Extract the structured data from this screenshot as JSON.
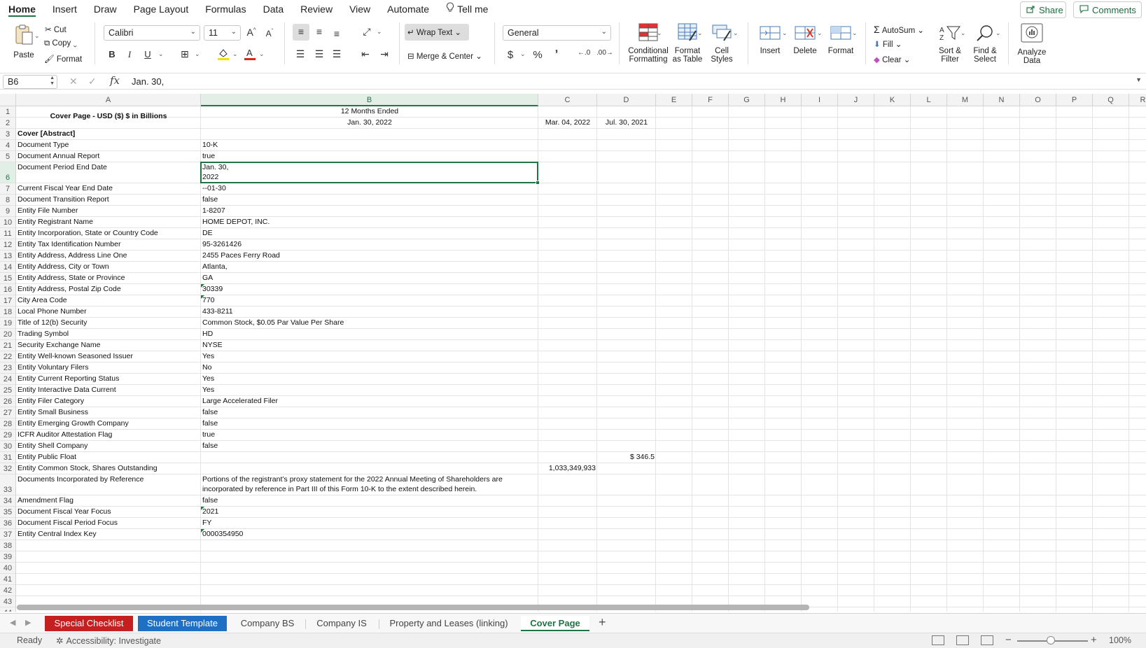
{
  "menu": {
    "tabs": [
      "Home",
      "Insert",
      "Draw",
      "Page Layout",
      "Formulas",
      "Data",
      "Review",
      "View",
      "Automate"
    ],
    "tell_me": "Tell me",
    "share": "Share",
    "comments": "Comments"
  },
  "ribbon": {
    "paste": "Paste",
    "cut": "Cut",
    "copy": "Copy",
    "format_painter": "Format",
    "font_name": "Calibri",
    "font_size": "11",
    "bold": "B",
    "italic": "I",
    "underline": "U",
    "wrap_text": "Wrap Text",
    "merge_center": "Merge & Center",
    "number_format": "General",
    "currency": "$",
    "percent": "%",
    "comma": "ʼ",
    "conditional_formatting": [
      "Conditional",
      "Formatting"
    ],
    "format_as_table": [
      "Format",
      "as Table"
    ],
    "cell_styles": [
      "Cell",
      "Styles"
    ],
    "insert": "Insert",
    "delete": "Delete",
    "format": "Format",
    "autosum": "AutoSum",
    "fill": "Fill",
    "clear": "Clear",
    "sort_filter": [
      "Sort &",
      "Filter"
    ],
    "find_select": [
      "Find &",
      "Select"
    ],
    "analyze_data": [
      "Analyze",
      "Data"
    ]
  },
  "formula_bar": {
    "name_box": "B6",
    "fx": "fx",
    "content": "Jan. 30,"
  },
  "grid": {
    "columns": [
      "A",
      "B",
      "C",
      "D",
      "E",
      "F",
      "G",
      "H",
      "I",
      "J",
      "K",
      "L",
      "M",
      "N",
      "O",
      "P",
      "Q",
      "R"
    ],
    "selected_column": "B",
    "selected_row": "6",
    "row_numbers": [
      "1",
      "2",
      "3",
      "4",
      "5",
      "6",
      "7",
      "8",
      "9",
      "10",
      "11",
      "12",
      "13",
      "14",
      "15",
      "16",
      "17",
      "18",
      "19",
      "20",
      "21",
      "22",
      "23",
      "24",
      "25",
      "26",
      "27",
      "28",
      "29",
      "30",
      "31",
      "32",
      "33",
      "34",
      "35",
      "36",
      "37",
      "38",
      "39",
      "40",
      "41",
      "42",
      "43",
      "44"
    ],
    "header_a": "Cover Page - USD ($) $ in Billions",
    "header_b1": "12 Months Ended",
    "header_b2": "Jan. 30, 2022",
    "header_c2": "Mar. 04, 2022",
    "header_d2": "Jul. 30, 2021",
    "rows": [
      {
        "r": "3",
        "a": "Cover [Abstract]",
        "b": "",
        "c": "",
        "d": ""
      },
      {
        "r": "4",
        "a": "Document Type",
        "b": "10-K",
        "c": "",
        "d": ""
      },
      {
        "r": "5",
        "a": "Document Annual Report",
        "b": "true",
        "c": "",
        "d": ""
      },
      {
        "r": "6",
        "a": "Document Period End Date",
        "b": "Jan. 30,",
        "b2": "2022",
        "c": "",
        "d": ""
      },
      {
        "r": "7",
        "a": "Current Fiscal Year End Date",
        "b": "--01-30",
        "c": "",
        "d": ""
      },
      {
        "r": "8",
        "a": "Document Transition Report",
        "b": "false",
        "c": "",
        "d": ""
      },
      {
        "r": "9",
        "a": "Entity File Number",
        "b": "1-8207",
        "c": "",
        "d": ""
      },
      {
        "r": "10",
        "a": "Entity Registrant Name",
        "b": "HOME DEPOT, INC.",
        "c": "",
        "d": ""
      },
      {
        "r": "11",
        "a": "Entity Incorporation, State or Country Code",
        "b": "DE",
        "c": "",
        "d": ""
      },
      {
        "r": "12",
        "a": "Entity Tax Identification Number",
        "b": "95-3261426",
        "c": "",
        "d": ""
      },
      {
        "r": "13",
        "a": "Entity Address, Address Line One",
        "b": "2455 Paces Ferry Road",
        "c": "",
        "d": ""
      },
      {
        "r": "14",
        "a": "Entity Address, City or Town",
        "b": "Atlanta,",
        "c": "",
        "d": ""
      },
      {
        "r": "15",
        "a": "Entity Address, State or Province",
        "b": "GA",
        "c": "",
        "d": ""
      },
      {
        "r": "16",
        "a": "Entity Address, Postal Zip Code",
        "b": "30339",
        "c": "",
        "d": ""
      },
      {
        "r": "17",
        "a": "City Area Code",
        "b": "770",
        "c": "",
        "d": ""
      },
      {
        "r": "18",
        "a": "Local Phone Number",
        "b": "433-8211",
        "c": "",
        "d": ""
      },
      {
        "r": "19",
        "a": "Title of 12(b) Security",
        "b": "Common Stock, $0.05 Par Value Per Share",
        "c": "",
        "d": ""
      },
      {
        "r": "20",
        "a": "Trading Symbol",
        "b": "HD",
        "c": "",
        "d": ""
      },
      {
        "r": "21",
        "a": "Security Exchange Name",
        "b": "NYSE",
        "c": "",
        "d": ""
      },
      {
        "r": "22",
        "a": "Entity Well-known Seasoned Issuer",
        "b": "Yes",
        "c": "",
        "d": ""
      },
      {
        "r": "23",
        "a": "Entity Voluntary Filers",
        "b": "No",
        "c": "",
        "d": ""
      },
      {
        "r": "24",
        "a": "Entity Current Reporting Status",
        "b": "Yes",
        "c": "",
        "d": ""
      },
      {
        "r": "25",
        "a": "Entity Interactive Data Current",
        "b": "Yes",
        "c": "",
        "d": ""
      },
      {
        "r": "26",
        "a": "Entity Filer Category",
        "b": "Large Accelerated Filer",
        "c": "",
        "d": ""
      },
      {
        "r": "27",
        "a": "Entity Small Business",
        "b": "false",
        "c": "",
        "d": ""
      },
      {
        "r": "28",
        "a": "Entity Emerging Growth Company",
        "b": "false",
        "c": "",
        "d": ""
      },
      {
        "r": "29",
        "a": "ICFR Auditor Attestation Flag",
        "b": "true",
        "c": "",
        "d": ""
      },
      {
        "r": "30",
        "a": "Entity Shell Company",
        "b": "false",
        "c": "",
        "d": ""
      },
      {
        "r": "31",
        "a": "Entity Public Float",
        "b": "",
        "c": "",
        "d": "$ 346.5"
      },
      {
        "r": "32",
        "a": "Entity Common Stock, Shares Outstanding",
        "b": "",
        "c": "1,033,349,933",
        "d": ""
      },
      {
        "r": "33",
        "a": "Documents Incorporated by Reference",
        "b": "Portions of the registrant’s proxy statement for the 2022 Annual Meeting of Shareholders are",
        "b2": "incorporated by reference in Part III of this Form 10-K to the extent described herein.",
        "c": "",
        "d": ""
      },
      {
        "r": "34",
        "a": "Amendment Flag",
        "b": "false",
        "c": "",
        "d": ""
      },
      {
        "r": "35",
        "a": "Document Fiscal Year Focus",
        "b": "2021",
        "c": "",
        "d": ""
      },
      {
        "r": "36",
        "a": "Document Fiscal Period Focus",
        "b": "FY",
        "c": "",
        "d": ""
      },
      {
        "r": "37",
        "a": "Entity Central Index Key",
        "b": "0000354950",
        "c": "",
        "d": ""
      }
    ],
    "text_number_flags": [
      "16",
      "17",
      "35",
      "37"
    ]
  },
  "sheets": {
    "tabs": [
      {
        "label": "Special Checklist",
        "style": "red"
      },
      {
        "label": "Student Template",
        "style": "blue"
      },
      {
        "label": "Company BS",
        "style": "plain"
      },
      {
        "label": "Company IS",
        "style": "plain"
      },
      {
        "label": "Property and Leases (linking)",
        "style": "plain"
      },
      {
        "label": "Cover Page",
        "style": "active"
      }
    ],
    "add": "+"
  },
  "status": {
    "ready": "Ready",
    "accessibility": "Accessibility: Investigate",
    "zoom": "100%"
  },
  "colors": {
    "accent": "#217346",
    "red_tab": "#c5201f",
    "blue_tab": "#1f6fc4"
  }
}
